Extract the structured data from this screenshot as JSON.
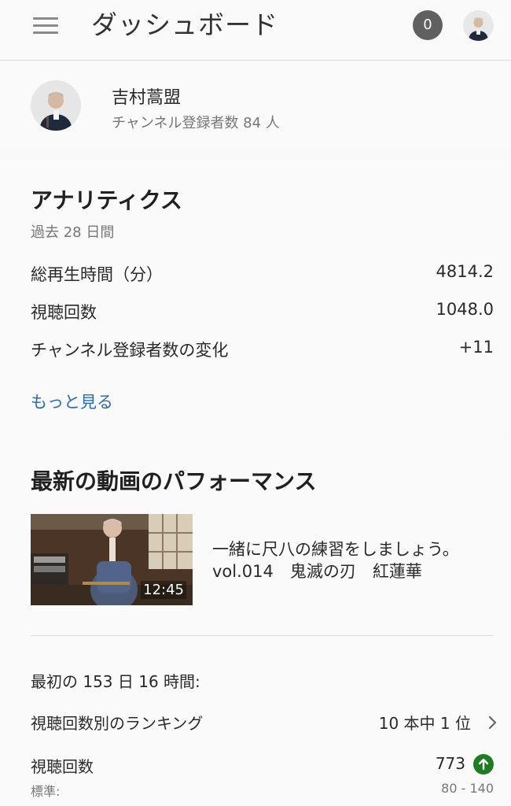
{
  "header": {
    "title": "ダッシュボード",
    "notification_count": "0",
    "icons": [
      "menu-icon",
      "profile-avatar"
    ]
  },
  "channel": {
    "name": "吉村蒿盟",
    "subscribers": "チャンネル登録者数 84 人"
  },
  "analytics": {
    "title": "アナリティクス",
    "period": "過去 28 日間",
    "metrics": [
      {
        "label": "総再生時間（分）",
        "value": "4814.2"
      },
      {
        "label": "視聴回数",
        "value": "1048.0"
      },
      {
        "label": "チャンネル登録者数の変化",
        "value": "+11"
      }
    ],
    "more_link": "もっと見る"
  },
  "latest_video": {
    "title": "最新の動画のパフォーマンス",
    "video_title": "一緒に尺八の練習をしましょう。 vol.014　鬼滅の刃　紅蓮華",
    "duration": "12:45",
    "first_period": "最初の 153 日 16 時間:",
    "ranking_label": "視聴回数別のランキング",
    "ranking_value": "10 本中 1 位",
    "views_label": "視聴回数",
    "views_value": "773",
    "normal_label": "標準:",
    "normal_range": "80 - 140"
  },
  "colors": {
    "accent_link": "#2a6cb5",
    "up_indicator": "#1e7d22",
    "badge": "#606060"
  }
}
